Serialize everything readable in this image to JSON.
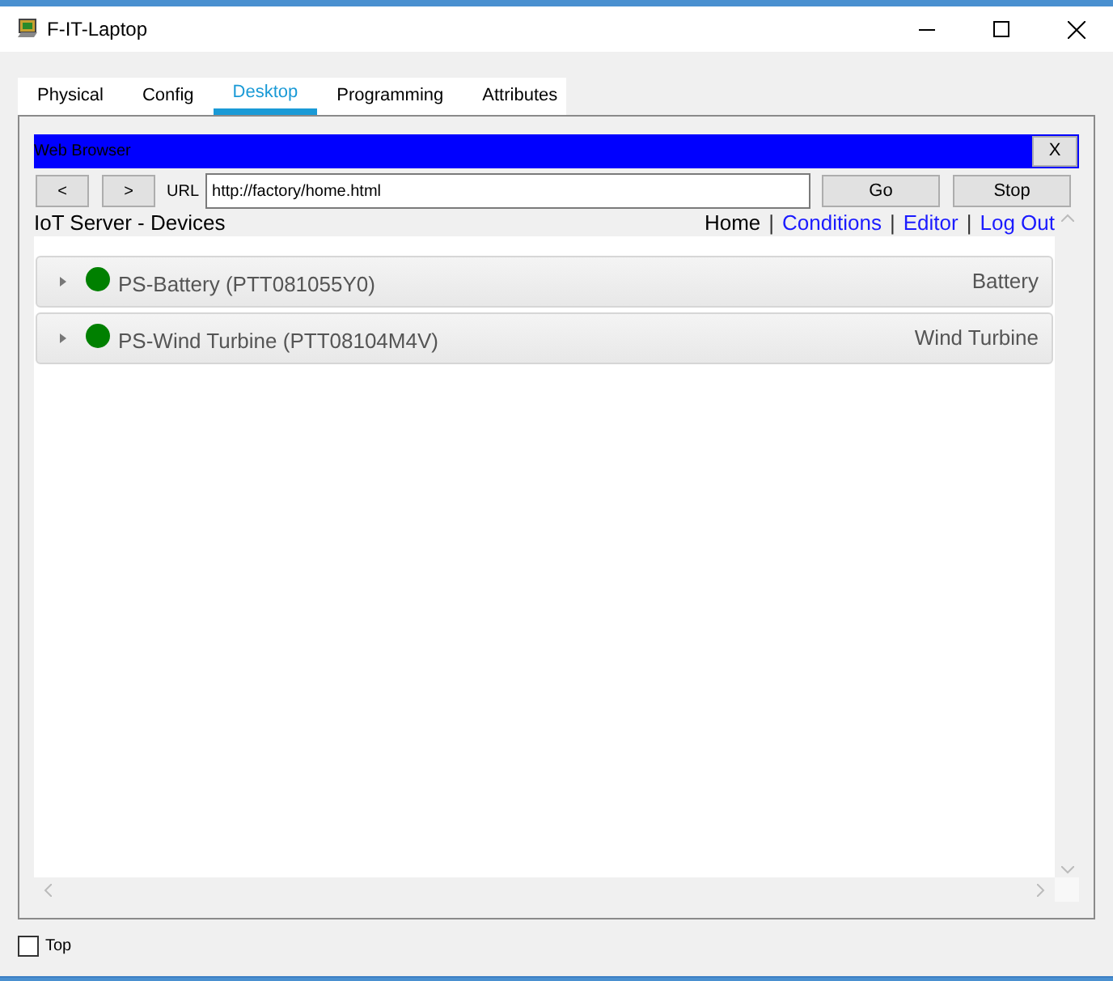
{
  "window": {
    "title": "F-IT-Laptop"
  },
  "tabs": [
    {
      "label": "Physical",
      "selected": false
    },
    {
      "label": "Config",
      "selected": false
    },
    {
      "label": "Desktop",
      "selected": true
    },
    {
      "label": "Programming",
      "selected": false
    },
    {
      "label": "Attributes",
      "selected": false
    }
  ],
  "browser": {
    "title": "Web Browser",
    "close": "X",
    "back": "<",
    "forward": ">",
    "url_label": "URL",
    "url": "http://factory/home.html",
    "go": "Go",
    "stop": "Stop"
  },
  "page": {
    "heading": "IoT Server - Devices",
    "nav": [
      {
        "label": "Home",
        "kind": "current"
      },
      {
        "label": "|",
        "kind": "separator"
      },
      {
        "label": "Conditions",
        "kind": "link"
      },
      {
        "label": "|",
        "kind": "separator"
      },
      {
        "label": "Editor",
        "kind": "link"
      },
      {
        "label": "|",
        "kind": "separator"
      },
      {
        "label": "Log Out",
        "kind": "link"
      }
    ],
    "devices": [
      {
        "name": "PS-Battery (PTT081055Y0)",
        "type": "Battery",
        "color": "#008000",
        "expanded": false
      },
      {
        "name": "PS-Wind Turbine (PTT08104M4V)",
        "type": "Wind Turbine",
        "color": "#008000",
        "expanded": false
      }
    ]
  },
  "top_checkbox": {
    "label": "Top",
    "checked": false
  }
}
